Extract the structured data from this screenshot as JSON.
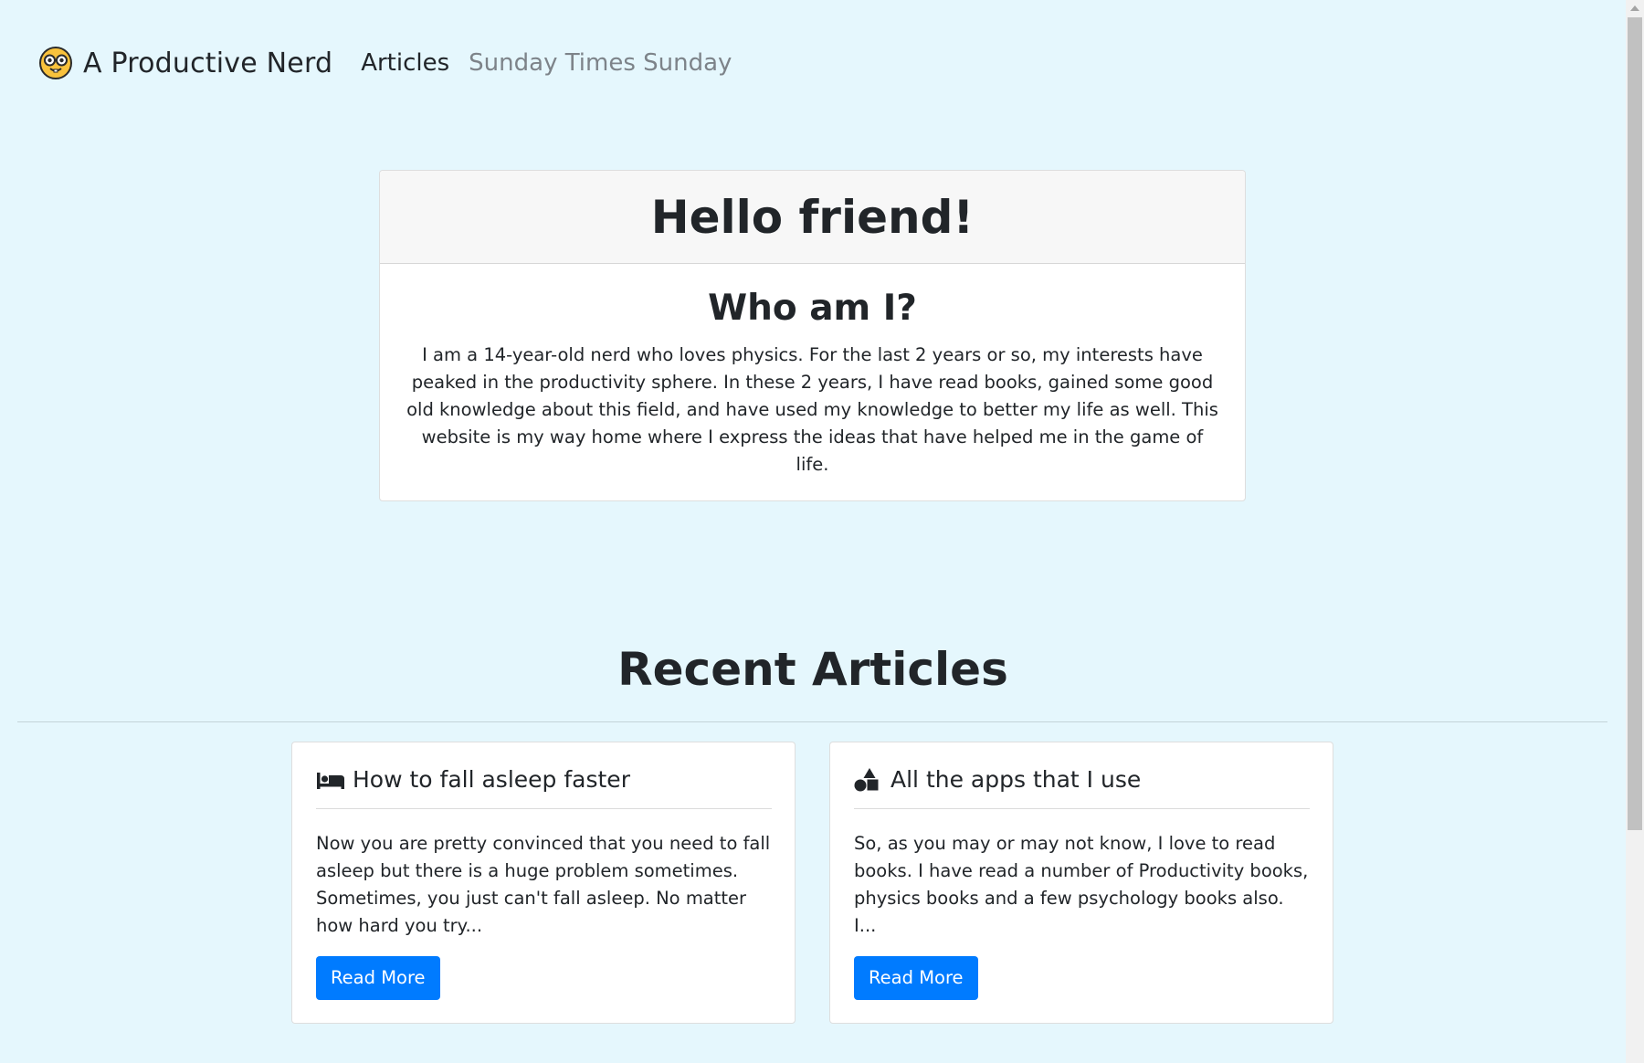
{
  "nav": {
    "brand": "A Productive Nerd",
    "brand_icon": "nerd-face-icon",
    "links": [
      {
        "label": "Articles",
        "active": true
      },
      {
        "label": "Sunday Times Sunday",
        "active": false
      }
    ]
  },
  "hero": {
    "title": "Hello friend!",
    "subtitle": "Who am I?",
    "text": "I am a 14-year-old nerd who loves physics. For the last 2 years or so, my interests have peaked in the productivity sphere. In these 2 years, I have read books, gained some good old knowledge about this field, and have used my knowledge to better my life as well. This website is my way home where I express the ideas that have helped me in the game of life."
  },
  "recent": {
    "title": "Recent Articles",
    "articles": [
      {
        "icon": "bed-icon",
        "title": "How to fall asleep faster",
        "excerpt": "Now you are pretty convinced that you need to fall asleep but there is a huge problem sometimes. Sometimes, you just can't fall asleep. No matter how hard you try...",
        "button": "Read More"
      },
      {
        "icon": "shapes-icon",
        "title": "All the apps that I use",
        "excerpt": "So, as you may or may not know, I love to read books. I have read a number of Productivity books, physics books and a few psychology books also. I...",
        "button": "Read More"
      }
    ]
  },
  "colors": {
    "background": "#e5f7fd",
    "primary": "#007bff",
    "muted_link": "#7d8389"
  }
}
